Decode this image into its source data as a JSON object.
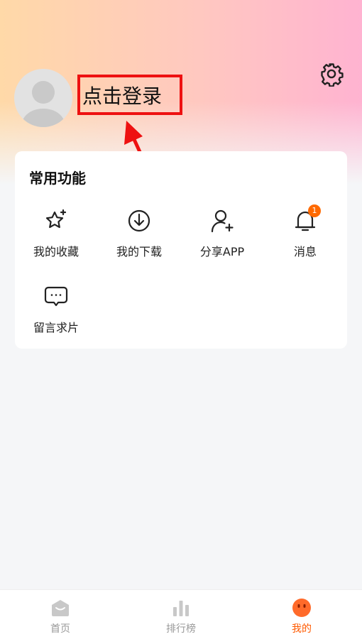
{
  "profile": {
    "login_text": "点击登录"
  },
  "functions": {
    "title": "常用功能",
    "items": [
      {
        "label": "我的收藏",
        "icon": "star-sparkle-icon"
      },
      {
        "label": "我的下载",
        "icon": "download-icon"
      },
      {
        "label": "分享APP",
        "icon": "add-user-icon"
      },
      {
        "label": "消息",
        "icon": "bell-icon",
        "badge": "1"
      },
      {
        "label": "留言求片",
        "icon": "message-bubble-icon"
      }
    ]
  },
  "tabbar": {
    "items": [
      {
        "label": "首页",
        "icon": "home-icon",
        "active": false
      },
      {
        "label": "排行榜",
        "icon": "bar-chart-icon",
        "active": false
      },
      {
        "label": "我的",
        "icon": "face-icon",
        "active": true
      }
    ]
  },
  "colors": {
    "accent": "#ff5a00",
    "highlight_box": "#ee1111",
    "badge": "#ff6a00"
  }
}
